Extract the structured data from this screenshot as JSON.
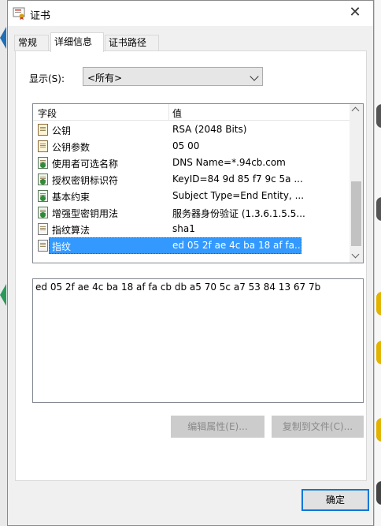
{
  "window": {
    "title": "证书",
    "close_glyph": "✕"
  },
  "tabs": [
    {
      "label": "常规",
      "active": false
    },
    {
      "label": "详细信息",
      "active": true
    },
    {
      "label": "证书路径",
      "active": false
    }
  ],
  "show": {
    "label": "显示(S):",
    "selected": "<所有>"
  },
  "list": {
    "columns": {
      "field": "字段",
      "value": "值"
    },
    "rows": [
      {
        "field": "公钥",
        "value": "RSA (2048 Bits)",
        "icon": "certificate-field-icon"
      },
      {
        "field": "公钥参数",
        "value": "05 00",
        "icon": "certificate-field-icon"
      },
      {
        "field": "使用者可选名称",
        "value": "DNS Name=*.94cb.com",
        "icon": "extension-icon"
      },
      {
        "field": "授权密钥标识符",
        "value": "KeyID=84 9d 85 f7 9c 5a ...",
        "icon": "extension-icon"
      },
      {
        "field": "基本约束",
        "value": "Subject Type=End Entity, ...",
        "icon": "extension-icon"
      },
      {
        "field": "增强型密钥用法",
        "value": "服务器身份验证 (1.3.6.1.5.5...",
        "icon": "extension-icon"
      },
      {
        "field": "指纹算法",
        "value": "sha1",
        "icon": "property-icon"
      },
      {
        "field": "指纹",
        "value": "ed 05 2f ae 4c ba 18 af fa...",
        "icon": "property-icon"
      }
    ]
  },
  "detail": {
    "text": "ed 05 2f ae 4c ba 18 af fa cb db a5 70 5c a7 53 84 13 67 7b"
  },
  "buttons": {
    "edit": "编辑属性(E)...",
    "copy": "复制到文件(C)...",
    "ok": "确定"
  }
}
